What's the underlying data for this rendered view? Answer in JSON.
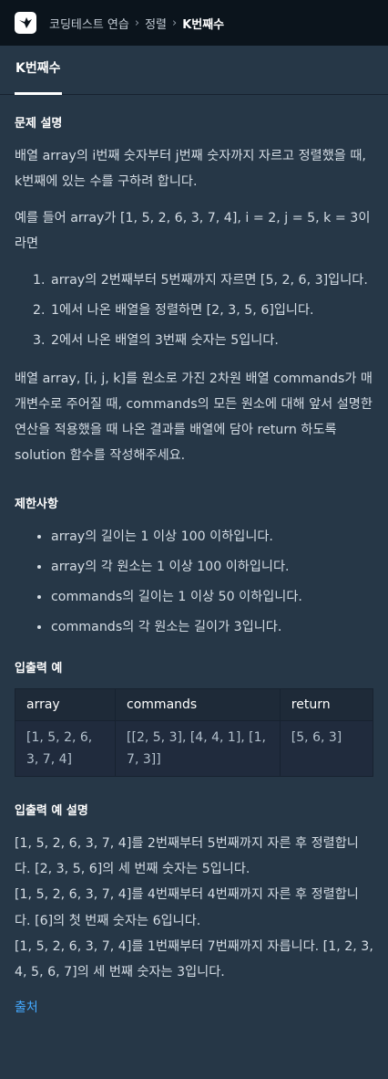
{
  "header": {
    "breadcrumbs": [
      "코딩테스트 연습",
      "정렬",
      "K번째수"
    ]
  },
  "tab": {
    "label": "K번째수"
  },
  "problem": {
    "title": "문제 설명",
    "p1": "배열 array의 i번째 숫자부터 j번째 숫자까지 자르고 정렬했을 때, k번째에 있는 수를 구하려 합니다.",
    "p2": "예를 들어 array가 [1, 5, 2, 6, 3, 7, 4], i = 2, j = 5, k = 3이라면",
    "steps": [
      "array의 2번째부터 5번째까지 자르면 [5, 2, 6, 3]입니다.",
      "1에서 나온 배열을 정렬하면 [2, 3, 5, 6]입니다.",
      "2에서 나온 배열의 3번째 숫자는 5입니다."
    ],
    "p3": "배열 array, [i, j, k]를 원소로 가진 2차원 배열 commands가 매개변수로 주어질 때, commands의 모든 원소에 대해 앞서 설명한 연산을 적용했을 때 나온 결과를 배열에 담아 return 하도록 solution 함수를 작성해주세요."
  },
  "constraints": {
    "title": "제한사항",
    "items": [
      "array의 길이는 1 이상 100 이하입니다.",
      "array의 각 원소는 1 이상 100 이하입니다.",
      "commands의 길이는 1 이상 50 이하입니다.",
      "commands의 각 원소는 길이가 3입니다."
    ]
  },
  "example": {
    "title": "입출력 예",
    "headers": [
      "array",
      "commands",
      "return"
    ],
    "row": [
      "[1, 5, 2, 6, 3, 7, 4]",
      "[[2, 5, 3], [4, 4, 1], [1, 7, 3]]",
      "[5, 6, 3]"
    ]
  },
  "explanation": {
    "title": "입출력 예 설명",
    "lines": [
      "[1, 5, 2, 6, 3, 7, 4]를 2번째부터 5번째까지 자른 후 정렬합니다. [2, 3, 5, 6]의 세 번째 숫자는 5입니다.",
      "[1, 5, 2, 6, 3, 7, 4]를 4번째부터 4번째까지 자른 후 정렬합니다. [6]의 첫 번째 숫자는 6입니다.",
      "[1, 5, 2, 6, 3, 7, 4]를 1번째부터 7번째까지 자릅니다. [1, 2, 3, 4, 5, 6, 7]의 세 번째 숫자는 3입니다."
    ]
  },
  "source_label": "출처"
}
